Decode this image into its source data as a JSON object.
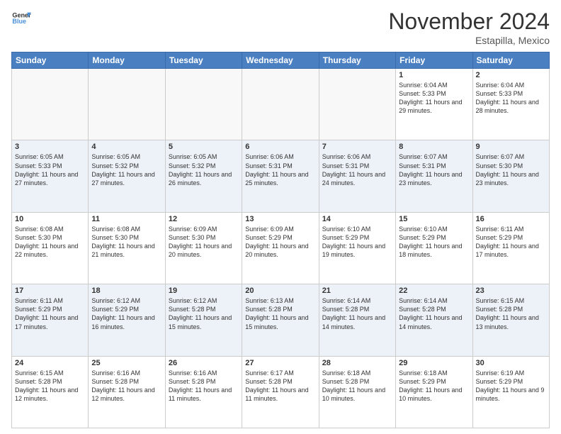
{
  "header": {
    "logo_line1": "General",
    "logo_line2": "Blue",
    "month": "November 2024",
    "location": "Estapilla, Mexico"
  },
  "weekdays": [
    "Sunday",
    "Monday",
    "Tuesday",
    "Wednesday",
    "Thursday",
    "Friday",
    "Saturday"
  ],
  "weeks": [
    [
      {
        "day": "",
        "info": ""
      },
      {
        "day": "",
        "info": ""
      },
      {
        "day": "",
        "info": ""
      },
      {
        "day": "",
        "info": ""
      },
      {
        "day": "",
        "info": ""
      },
      {
        "day": "1",
        "info": "Sunrise: 6:04 AM\nSunset: 5:33 PM\nDaylight: 11 hours and 29 minutes."
      },
      {
        "day": "2",
        "info": "Sunrise: 6:04 AM\nSunset: 5:33 PM\nDaylight: 11 hours and 28 minutes."
      }
    ],
    [
      {
        "day": "3",
        "info": "Sunrise: 6:05 AM\nSunset: 5:33 PM\nDaylight: 11 hours and 27 minutes."
      },
      {
        "day": "4",
        "info": "Sunrise: 6:05 AM\nSunset: 5:32 PM\nDaylight: 11 hours and 27 minutes."
      },
      {
        "day": "5",
        "info": "Sunrise: 6:05 AM\nSunset: 5:32 PM\nDaylight: 11 hours and 26 minutes."
      },
      {
        "day": "6",
        "info": "Sunrise: 6:06 AM\nSunset: 5:31 PM\nDaylight: 11 hours and 25 minutes."
      },
      {
        "day": "7",
        "info": "Sunrise: 6:06 AM\nSunset: 5:31 PM\nDaylight: 11 hours and 24 minutes."
      },
      {
        "day": "8",
        "info": "Sunrise: 6:07 AM\nSunset: 5:31 PM\nDaylight: 11 hours and 23 minutes."
      },
      {
        "day": "9",
        "info": "Sunrise: 6:07 AM\nSunset: 5:30 PM\nDaylight: 11 hours and 23 minutes."
      }
    ],
    [
      {
        "day": "10",
        "info": "Sunrise: 6:08 AM\nSunset: 5:30 PM\nDaylight: 11 hours and 22 minutes."
      },
      {
        "day": "11",
        "info": "Sunrise: 6:08 AM\nSunset: 5:30 PM\nDaylight: 11 hours and 21 minutes."
      },
      {
        "day": "12",
        "info": "Sunrise: 6:09 AM\nSunset: 5:30 PM\nDaylight: 11 hours and 20 minutes."
      },
      {
        "day": "13",
        "info": "Sunrise: 6:09 AM\nSunset: 5:29 PM\nDaylight: 11 hours and 20 minutes."
      },
      {
        "day": "14",
        "info": "Sunrise: 6:10 AM\nSunset: 5:29 PM\nDaylight: 11 hours and 19 minutes."
      },
      {
        "day": "15",
        "info": "Sunrise: 6:10 AM\nSunset: 5:29 PM\nDaylight: 11 hours and 18 minutes."
      },
      {
        "day": "16",
        "info": "Sunrise: 6:11 AM\nSunset: 5:29 PM\nDaylight: 11 hours and 17 minutes."
      }
    ],
    [
      {
        "day": "17",
        "info": "Sunrise: 6:11 AM\nSunset: 5:29 PM\nDaylight: 11 hours and 17 minutes."
      },
      {
        "day": "18",
        "info": "Sunrise: 6:12 AM\nSunset: 5:29 PM\nDaylight: 11 hours and 16 minutes."
      },
      {
        "day": "19",
        "info": "Sunrise: 6:12 AM\nSunset: 5:28 PM\nDaylight: 11 hours and 15 minutes."
      },
      {
        "day": "20",
        "info": "Sunrise: 6:13 AM\nSunset: 5:28 PM\nDaylight: 11 hours and 15 minutes."
      },
      {
        "day": "21",
        "info": "Sunrise: 6:14 AM\nSunset: 5:28 PM\nDaylight: 11 hours and 14 minutes."
      },
      {
        "day": "22",
        "info": "Sunrise: 6:14 AM\nSunset: 5:28 PM\nDaylight: 11 hours and 14 minutes."
      },
      {
        "day": "23",
        "info": "Sunrise: 6:15 AM\nSunset: 5:28 PM\nDaylight: 11 hours and 13 minutes."
      }
    ],
    [
      {
        "day": "24",
        "info": "Sunrise: 6:15 AM\nSunset: 5:28 PM\nDaylight: 11 hours and 12 minutes."
      },
      {
        "day": "25",
        "info": "Sunrise: 6:16 AM\nSunset: 5:28 PM\nDaylight: 11 hours and 12 minutes."
      },
      {
        "day": "26",
        "info": "Sunrise: 6:16 AM\nSunset: 5:28 PM\nDaylight: 11 hours and 11 minutes."
      },
      {
        "day": "27",
        "info": "Sunrise: 6:17 AM\nSunset: 5:28 PM\nDaylight: 11 hours and 11 minutes."
      },
      {
        "day": "28",
        "info": "Sunrise: 6:18 AM\nSunset: 5:28 PM\nDaylight: 11 hours and 10 minutes."
      },
      {
        "day": "29",
        "info": "Sunrise: 6:18 AM\nSunset: 5:29 PM\nDaylight: 11 hours and 10 minutes."
      },
      {
        "day": "30",
        "info": "Sunrise: 6:19 AM\nSunset: 5:29 PM\nDaylight: 11 hours and 9 minutes."
      }
    ]
  ]
}
